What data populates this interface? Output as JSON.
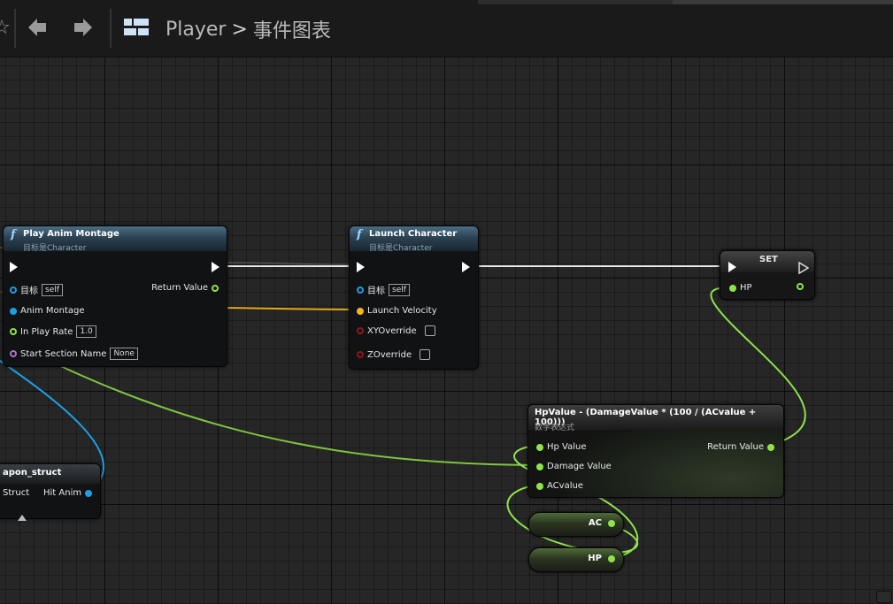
{
  "toolbar": {
    "partial_icon": "star-icon",
    "back": "arrow-left-icon",
    "forward": "arrow-right-icon",
    "graph_icon": "blueprint-graph-icon"
  },
  "breadcrumb": {
    "root": "Player",
    "separator": ">",
    "current": "事件图表"
  },
  "nodes": {
    "play_anim_montage": {
      "title": "Play Anim Montage",
      "subtitle": "目标是Character",
      "target_label": "目标",
      "target_value": "self",
      "return_label": "Return Value",
      "anim_montage_label": "Anim Montage",
      "play_rate_label": "In Play Rate",
      "play_rate_value": "1.0",
      "section_label": "Start Section Name",
      "section_value": "None"
    },
    "launch_character": {
      "title": "Launch Character",
      "subtitle": "目标是Character",
      "target_label": "目标",
      "target_value": "self",
      "velocity_label": "Launch Velocity",
      "xy_label": "XYOverride",
      "z_label": "ZOverride"
    },
    "set_hp": {
      "title": "SET",
      "pin_label": "HP"
    },
    "math_expr": {
      "title": "HpValue - (DamageValue * (100 / (ACvalue + 100)))",
      "subtitle": "数学表达式",
      "in1": "Hp Value",
      "in2": "Damage Value",
      "in3": "ACvalue",
      "out": "Return Value"
    },
    "break_struct": {
      "title": "apon_struct",
      "left_label": "Struct",
      "right_label": "Hit Anim"
    },
    "var_ac": {
      "label": "AC"
    },
    "var_hp": {
      "label": "HP"
    }
  },
  "colors": {
    "exec": "#ffffff",
    "object": "#1aa0e8",
    "float": "#8fe34a",
    "vector": "#f3b620",
    "name": "#b06fd3",
    "bool": "#8c1a1a"
  }
}
